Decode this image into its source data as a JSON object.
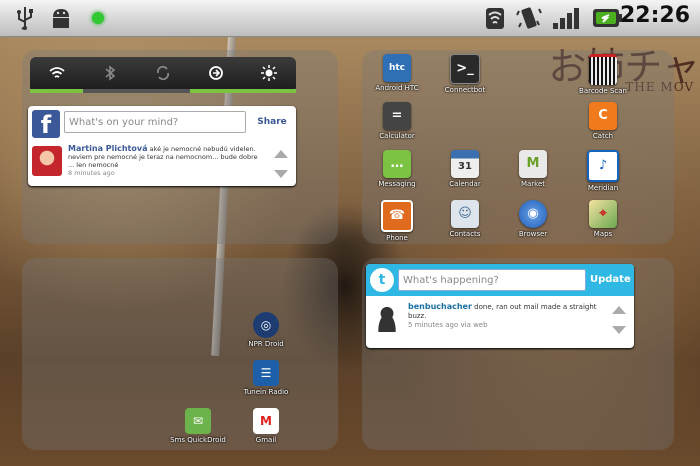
{
  "status_bar": {
    "time": "22:26",
    "left_icons": [
      "usb-icon",
      "android-debug-icon",
      "notification-dot-icon"
    ],
    "right_icons": [
      "wifi-icon",
      "vibrate-icon",
      "signal-icon",
      "battery-icon"
    ]
  },
  "wallpaper": {
    "kanji_text": "お姉チャ",
    "subtitle_text": "THE MOV"
  },
  "power_control": {
    "toggles": [
      {
        "name": "wifi",
        "icon": "wifi-icon",
        "on": true
      },
      {
        "name": "bluetooth",
        "icon": "bluetooth-icon",
        "on": false
      },
      {
        "name": "sync",
        "icon": "sync-icon",
        "on": false
      },
      {
        "name": "auto-sync",
        "icon": "sync-icon",
        "on": true
      },
      {
        "name": "brightness",
        "icon": "brightness-icon",
        "on": true
      }
    ]
  },
  "facebook": {
    "placeholder": "What's on your mind?",
    "share_label": "Share",
    "post_author": "Martina Plichtová",
    "post_text": "aké je nemocné nebudú videlen. neviem pre nemocné je teraz na nemocnom... bude dobre ... len nemocné",
    "post_time": "8 minutes ago"
  },
  "apps": [
    {
      "label": "Android HTC",
      "color": "#2e6fb5",
      "glyph": "htc"
    },
    {
      "label": "Connectbot",
      "color": "#2a2a2a",
      "glyph": ">_"
    },
    {
      "label": "Barcode Scan",
      "color": "#222",
      "glyph": "|||"
    },
    {
      "label": "Calculator",
      "color": "#444",
      "glyph": "="
    },
    {
      "label": "Catch",
      "color": "#f07a1c",
      "glyph": "C"
    },
    {
      "label": "Messaging",
      "color": "#7cc243",
      "glyph": "..."
    },
    {
      "label": "Calendar",
      "color": "#3a6fb0",
      "glyph": "31"
    },
    {
      "label": "Market",
      "color": "#8bc34a",
      "glyph": "M"
    },
    {
      "label": "Meridian",
      "color": "#1565c0",
      "glyph": "♪"
    },
    {
      "label": "Phone",
      "color": "#e06b1e",
      "glyph": "☎"
    },
    {
      "label": "Contacts",
      "color": "#6a8fb5",
      "glyph": "☺"
    },
    {
      "label": "Browser",
      "color": "#1e5fb8",
      "glyph": "◉"
    },
    {
      "label": "Maps",
      "color": "#6aa84f",
      "glyph": "⌖"
    }
  ],
  "twitter": {
    "placeholder": "What's happening?",
    "update_label": "Update",
    "post_author": "benbuchacher",
    "post_text": "done, ran out mail made a straight buzz.",
    "post_time": "5 minutes ago via web"
  },
  "shortcuts": [
    {
      "label": "NPR Droid",
      "color": "#1d3c72",
      "glyph": "◎"
    },
    {
      "label": "Tunein Radio",
      "color": "#1d5fa8",
      "glyph": "☰"
    },
    {
      "label": "Gmail",
      "color": "#ffffff",
      "glyph": "M"
    },
    {
      "label": "Sms QuickDroid",
      "color": "#6bb34a",
      "glyph": "✉"
    }
  ]
}
